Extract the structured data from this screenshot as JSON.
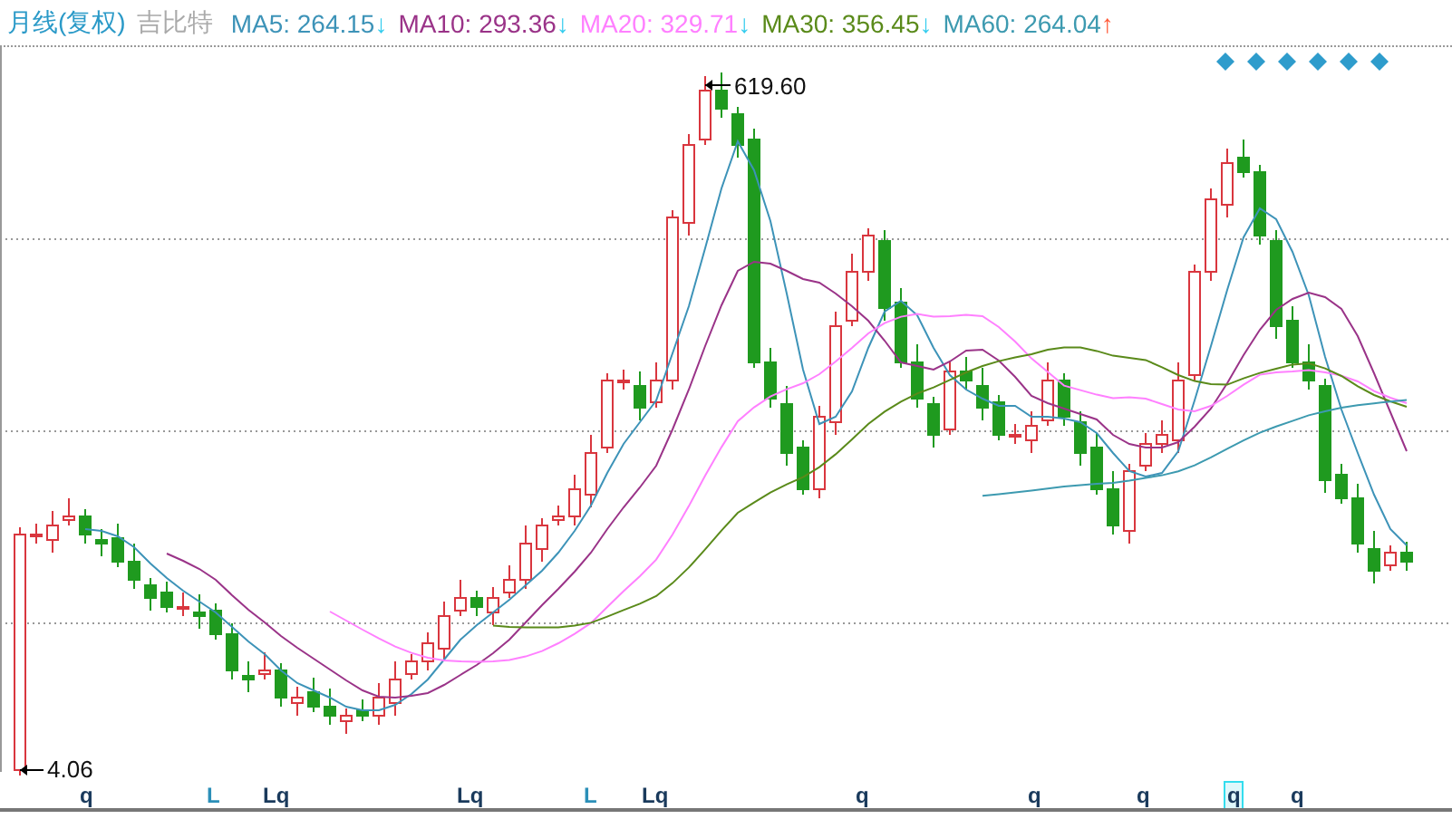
{
  "header": {
    "period": "月线(复权)",
    "stock_name": "吉比特",
    "indicators": [
      {
        "label": "MA5: 264.15",
        "arrow": "↓",
        "color": "#3d93b8",
        "rising": false
      },
      {
        "label": "MA10: 293.36",
        "arrow": "↓",
        "color": "#9a3388",
        "rising": false
      },
      {
        "label": "MA20: 329.71",
        "arrow": "↓",
        "color": "#ff80ff",
        "rising": false
      },
      {
        "label": "MA30: 356.45",
        "arrow": "↓",
        "color": "#5a8a1a",
        "rising": false
      },
      {
        "label": "MA60: 264.04",
        "arrow": "↑",
        "color": "#3d9ab0",
        "rising": true
      }
    ]
  },
  "chart": {
    "high_label": "619.60",
    "low_label": "4.06"
  },
  "markers": [
    {
      "text": "q",
      "color": "#1a3a5c",
      "selected": false
    },
    {
      "text": "L",
      "color": "#2b8fb8",
      "selected": false
    },
    {
      "text": "Lq",
      "color": "#1a3a5c",
      "selected": false
    },
    {
      "text": "Lq",
      "color": "#1a3a5c",
      "selected": false
    },
    {
      "text": "L",
      "color": "#2b8fb8",
      "selected": false
    },
    {
      "text": "Lq",
      "color": "#1a3a5c",
      "selected": false
    },
    {
      "text": "q",
      "color": "#1a3a5c",
      "selected": false
    },
    {
      "text": "q",
      "color": "#1a3a5c",
      "selected": false
    },
    {
      "text": "q",
      "color": "#1a3a5c",
      "selected": false
    },
    {
      "text": "q",
      "color": "#1a3a5c",
      "selected": true
    },
    {
      "text": "q",
      "color": "#1a3a5c",
      "selected": false
    }
  ]
}
